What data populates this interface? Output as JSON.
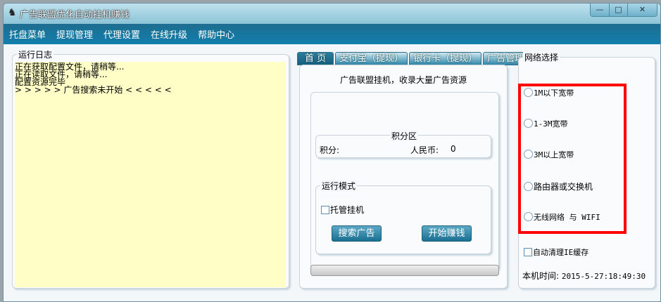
{
  "window": {
    "title": "广告联盟优化自动挂机赚钱",
    "minimize": "—",
    "maximize": "□",
    "close": "✕"
  },
  "menu": [
    "托盘菜单",
    "提现管理",
    "代理设置",
    "在线升级",
    "帮助中心"
  ],
  "log": {
    "label": "运行日志",
    "lines": [
      "正在获取配置文件，请稍等...",
      "正在读取文件，请稍等...",
      "配置资源完毕",
      "> > > > > 广告搜索未开始 < < < < <"
    ]
  },
  "tabs": [
    "首 页",
    "支付宝（提现）",
    "银行卡（提现）",
    "广告管理"
  ],
  "home": {
    "slogan": "广告联盟挂机，收录大量广告资源",
    "points_group": "积分区",
    "points_label": "积分:",
    "rmb_label": "人民币:",
    "rmb_value": "0",
    "mode_group": "运行模式",
    "hosted_label": "托管挂机",
    "search_button": "搜索广告",
    "start_button": "开始赚钱",
    "progress": 0
  },
  "network": {
    "label": "网络选择",
    "options": [
      "1M以下宽带",
      "1-3M宽带",
      "3M以上宽带",
      "路由器或交换机",
      "无线网络 与 WIFI"
    ],
    "auto_clean": "自动清理IE缓存",
    "time_label": "本机时间:",
    "time_value": "2015-5-27:18:49:30"
  },
  "colors": {
    "highlight": "#ff0000",
    "log_bg": "#fefec6",
    "menubar": "#1a76a0"
  }
}
